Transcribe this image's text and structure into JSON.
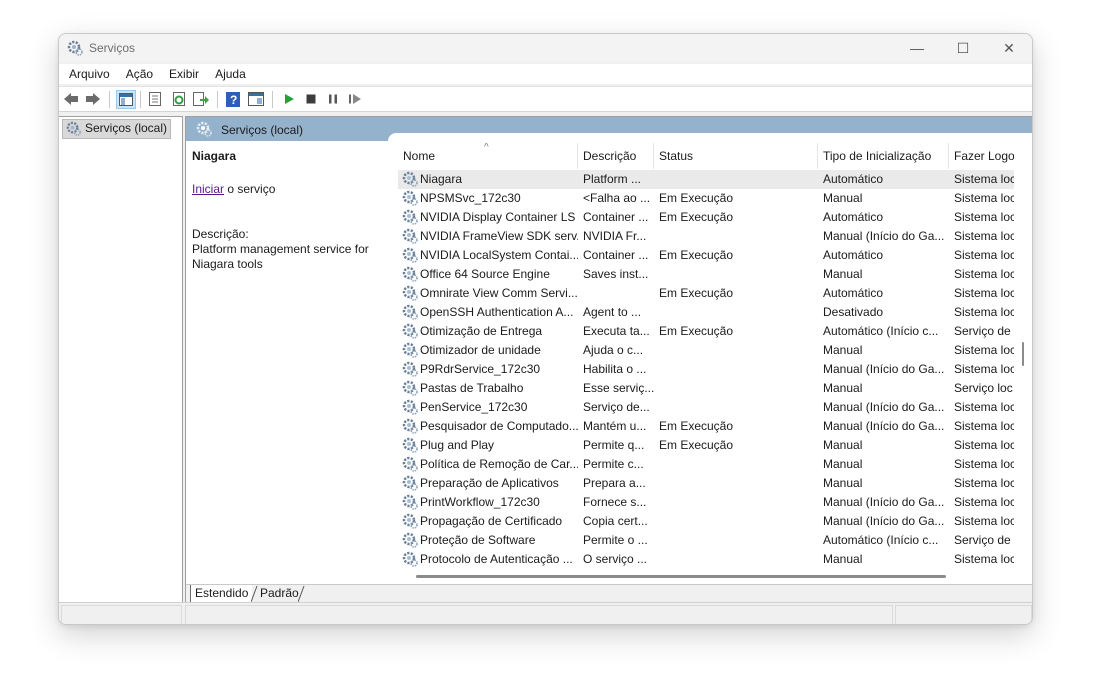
{
  "window": {
    "title": "Serviços",
    "minimize_glyph": "—",
    "maximize_glyph": "☐",
    "close_glyph": "✕"
  },
  "menu": [
    "Arquivo",
    "Ação",
    "Exibir",
    "Ajuda"
  ],
  "toolbar": [
    "back-icon",
    "forward-icon",
    "show-hide-tree-icon",
    "properties-icon",
    "refresh-icon",
    "export-list-icon",
    "help-icon",
    "console-icon",
    "start-icon",
    "stop-icon",
    "pause-icon",
    "resume-icon"
  ],
  "tree": {
    "root_label": "Serviços (local)"
  },
  "pane": {
    "header": "Serviços (local)",
    "selected_name": "Niagara",
    "start_link": "Iniciar",
    "start_suffix": " o serviço",
    "desc_label": "Descrição:",
    "desc_text": "Platform management service for Niagara tools"
  },
  "columns": [
    "Nome",
    "Descrição",
    "Status",
    "Tipo de Inicialização",
    "Fazer Logo"
  ],
  "rows": [
    {
      "name": "Niagara",
      "desc": "Platform ...",
      "status": "",
      "startup": "Automático",
      "logon": "Sistema loc",
      "selected": true
    },
    {
      "name": "NPSMSvc_172c30",
      "desc": "<Falha ao ...",
      "status": "Em Execução",
      "startup": "Manual",
      "logon": "Sistema loc"
    },
    {
      "name": "NVIDIA Display Container LS",
      "desc": "Container ...",
      "status": "Em Execução",
      "startup": "Automático",
      "logon": "Sistema loc"
    },
    {
      "name": "NVIDIA FrameView SDK serv...",
      "desc": "NVIDIA Fr...",
      "status": "",
      "startup": "Manual (Início do Ga...",
      "logon": "Sistema loc"
    },
    {
      "name": "NVIDIA LocalSystem Contai...",
      "desc": "Container ...",
      "status": "Em Execução",
      "startup": "Automático",
      "logon": "Sistema loc"
    },
    {
      "name": "Office 64 Source Engine",
      "desc": "Saves inst...",
      "status": "",
      "startup": "Manual",
      "logon": "Sistema loc"
    },
    {
      "name": "Omnirate View Comm Servi...",
      "desc": "",
      "status": "Em Execução",
      "startup": "Automático",
      "logon": "Sistema loc"
    },
    {
      "name": "OpenSSH Authentication A...",
      "desc": "Agent to ...",
      "status": "",
      "startup": "Desativado",
      "logon": "Sistema loc"
    },
    {
      "name": "Otimização de Entrega",
      "desc": "Executa ta...",
      "status": "Em Execução",
      "startup": "Automático (Início c...",
      "logon": "Serviço de"
    },
    {
      "name": "Otimizador de unidade",
      "desc": "Ajuda o c...",
      "status": "",
      "startup": "Manual",
      "logon": "Sistema loc"
    },
    {
      "name": "P9RdrService_172c30",
      "desc": "Habilita o ...",
      "status": "",
      "startup": "Manual (Início do Ga...",
      "logon": "Sistema loc"
    },
    {
      "name": "Pastas de Trabalho",
      "desc": "Esse serviç...",
      "status": "",
      "startup": "Manual",
      "logon": "Serviço loc"
    },
    {
      "name": "PenService_172c30",
      "desc": "Serviço de...",
      "status": "",
      "startup": "Manual (Início do Ga...",
      "logon": "Sistema loc"
    },
    {
      "name": "Pesquisador de Computado...",
      "desc": "Mantém u...",
      "status": "Em Execução",
      "startup": "Manual (Início do Ga...",
      "logon": "Sistema loc"
    },
    {
      "name": "Plug and Play",
      "desc": "Permite q...",
      "status": "Em Execução",
      "startup": "Manual",
      "logon": "Sistema loc"
    },
    {
      "name": "Política de Remoção de Car...",
      "desc": "Permite c...",
      "status": "",
      "startup": "Manual",
      "logon": "Sistema loc"
    },
    {
      "name": "Preparação de Aplicativos",
      "desc": "Prepara a...",
      "status": "",
      "startup": "Manual",
      "logon": "Sistema loc"
    },
    {
      "name": "PrintWorkflow_172c30",
      "desc": "Fornece s...",
      "status": "",
      "startup": "Manual (Início do Ga...",
      "logon": "Sistema loc"
    },
    {
      "name": "Propagação de Certificado",
      "desc": "Copia cert...",
      "status": "",
      "startup": "Manual (Início do Ga...",
      "logon": "Sistema loc"
    },
    {
      "name": "Proteção de Software",
      "desc": "Permite o ...",
      "status": "",
      "startup": "Automático (Início c...",
      "logon": "Serviço de"
    },
    {
      "name": "Protocolo de Autenticação ...",
      "desc": "O serviço ...",
      "status": "",
      "startup": "Manual",
      "logon": "Sistema loc"
    }
  ],
  "view_tabs": [
    "Estendido",
    "Padrão"
  ],
  "colors": {
    "pane_header": "#95b2cd",
    "selected_row": "#eaeaea",
    "link": "#551a8b"
  }
}
